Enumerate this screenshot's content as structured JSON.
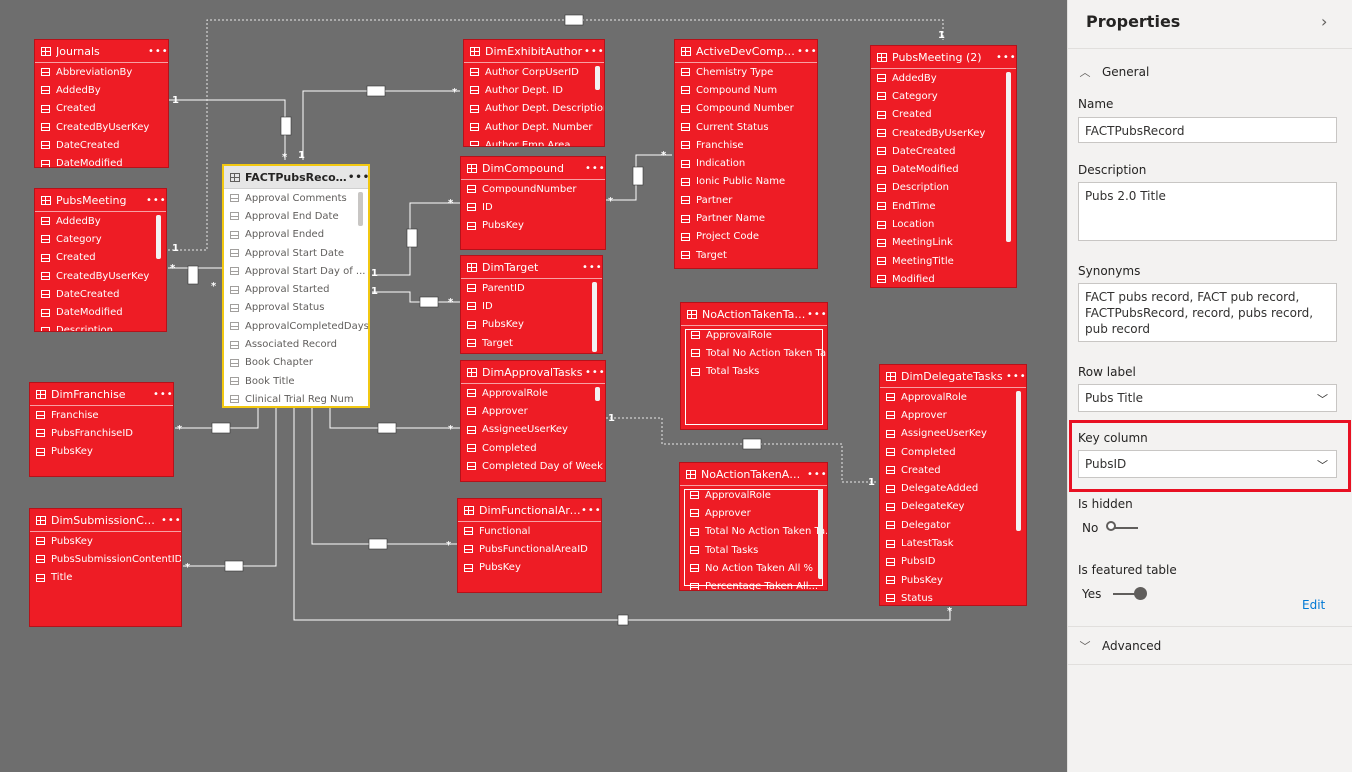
{
  "diagram": {
    "tables": [
      {
        "id": "journals",
        "name": "Journals",
        "rows": [
          "AbbreviationBy",
          "AddedBy",
          "Created",
          "CreatedByUserKey",
          "DateCreated",
          "DateModified"
        ]
      },
      {
        "id": "dimexhibitauthor",
        "name": "DimExhibitAuthor",
        "rows": [
          "Author CorpUserID",
          "Author Dept. ID",
          "Author Dept. Description",
          "Author Dept. Number",
          "Author Emp Area"
        ]
      },
      {
        "id": "activedevcompound",
        "name": "ActiveDevCompound...",
        "rows": [
          "Chemistry Type",
          "Compound Num",
          "Compound Number",
          "Current Status",
          "Franchise",
          "Indication",
          "Ionic Public Name",
          "Partner",
          "Partner Name",
          "Project Code",
          "Target"
        ]
      },
      {
        "id": "pubsmeeting2",
        "name": "PubsMeeting (2)",
        "rows": [
          "AddedBy",
          "Category",
          "Created",
          "CreatedByUserKey",
          "DateCreated",
          "DateModified",
          "Description",
          "EndTime",
          "Location",
          "MeetingLink",
          "MeetingTitle",
          "Modified"
        ]
      },
      {
        "id": "pubsmeeting",
        "name": "PubsMeeting",
        "rows": [
          "AddedBy",
          "Category",
          "Created",
          "CreatedByUserKey",
          "DateCreated",
          "DateModified",
          "Description"
        ]
      },
      {
        "id": "factpubsrecord",
        "name": "FACTPubsRecord",
        "rows": [
          "Approval Comments",
          "Approval End Date",
          "Approval Ended",
          "Approval Start Date",
          "Approval Start Day of ...",
          "Approval Started",
          "Approval Status",
          "ApprovalCompletedDays",
          "Associated Record",
          "Book Chapter",
          "Book Title",
          "Clinical Trial Reg Num"
        ]
      },
      {
        "id": "dimcompound",
        "name": "DimCompound",
        "rows": [
          "CompoundNumber",
          "ID",
          "PubsKey"
        ]
      },
      {
        "id": "dimtarget",
        "name": "DimTarget",
        "rows": [
          "ParentID",
          "ID",
          "PubsKey",
          "Target"
        ]
      },
      {
        "id": "noactiontaken",
        "name": "NoActionTakenTask...",
        "rows": [
          "ApprovalRole",
          "Total No Action Taken Ta...",
          "Total Tasks"
        ]
      },
      {
        "id": "dimfranchise",
        "name": "DimFranchise",
        "rows": [
          "Franchise",
          "PubsFranchiseID",
          "PubsKey"
        ]
      },
      {
        "id": "dimapprovaltasks",
        "name": "DimApprovalTasks",
        "rows": [
          "ApprovalRole",
          "Approver",
          "AssigneeUserKey",
          "Completed",
          "Completed Day of Week"
        ]
      },
      {
        "id": "dimdelegatetasks",
        "name": "DimDelegateTasks",
        "rows": [
          "ApprovalRole",
          "Approver",
          "AssigneeUserKey",
          "Completed",
          "Created",
          "DelegateAdded",
          "DelegateKey",
          "Delegator",
          "LatestTask",
          "PubsID",
          "PubsKey",
          "Status"
        ]
      },
      {
        "id": "dimsubmission",
        "name": "DimSubmissionConte...",
        "rows": [
          "PubsKey",
          "PubsSubmissionContentID...",
          "Title"
        ]
      },
      {
        "id": "dimfunctionalarea",
        "name": "DimFunctionalArea",
        "rows": [
          "Functional",
          "PubsFunctionalAreaID",
          "PubsKey"
        ]
      },
      {
        "id": "noactiontakenapp",
        "name": "NoActionTakenAppro...",
        "rows": [
          "ApprovalRole",
          "Approver",
          "Total No Action Taken Ta...",
          "Total Tasks",
          "No Action Taken All %",
          "Percentage Taken All..."
        ]
      }
    ],
    "card_one": "1",
    "card_many": "*"
  },
  "properties": {
    "title": "Properties",
    "general_label": "General",
    "name_label": "Name",
    "name_value": "FACTPubsRecord",
    "description_label": "Description",
    "description_value": "Pubs 2.0 Title",
    "synonyms_label": "Synonyms",
    "synonyms_value": "FACT pubs record, FACT pub record, FACTPubsRecord, record, pubs record, pub record",
    "row_label_label": "Row label",
    "row_label_value": "Pubs Title",
    "key_column_label": "Key column",
    "key_column_value": "PubsID",
    "is_hidden_label": "Is hidden",
    "is_hidden_value": "No",
    "is_featured_label": "Is featured table",
    "is_featured_value": "Yes",
    "edit_label": "Edit",
    "advanced_label": "Advanced",
    "accent_color": "#e81123",
    "link_color": "#0078d4"
  }
}
